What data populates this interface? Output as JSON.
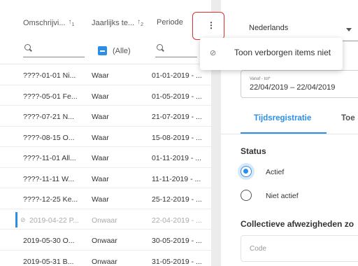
{
  "grid": {
    "columns": [
      {
        "label": "Omschrijvi...",
        "sort": "↑",
        "sort_index": "1"
      },
      {
        "label": "Jaarlijks te...",
        "sort": "↑",
        "sort_index": "2"
      },
      {
        "label": "Periode"
      }
    ],
    "menu_icon": "more-vertical-icon",
    "filter_select_all": "(Alle)",
    "rows": [
      {
        "omschrijving": "????-01-01 Ni...",
        "jaarlijks": "Waar",
        "periode": "01-01-2019 - ..."
      },
      {
        "omschrijving": "????-05-01 Fe...",
        "jaarlijks": "Waar",
        "periode": "01-05-2019 - ..."
      },
      {
        "omschrijving": "????-07-21 N...",
        "jaarlijks": "Waar",
        "periode": "21-07-2019 - ..."
      },
      {
        "omschrijving": "????-08-15 O...",
        "jaarlijks": "Waar",
        "periode": "15-08-2019 - ..."
      },
      {
        "omschrijving": "????-11-01 All...",
        "jaarlijks": "Waar",
        "periode": "01-11-2019 - ..."
      },
      {
        "omschrijving": "????-11-11 W...",
        "jaarlijks": "Waar",
        "periode": "11-11-2019 - ..."
      },
      {
        "omschrijving": "????-12-25 Ke...",
        "jaarlijks": "Waar",
        "periode": "25-12-2019 - ..."
      },
      {
        "omschrijving": "2019-04-22 P...",
        "jaarlijks": "Onwaar",
        "periode": "22-04-2019 - ...",
        "hidden": true
      },
      {
        "omschrijving": "2019-05-30 O...",
        "jaarlijks": "Onwaar",
        "periode": "30-05-2019 - ..."
      },
      {
        "omschrijving": "2019-05-31 B...",
        "jaarlijks": "Onwaar",
        "periode": "31-05-2019 - ..."
      }
    ]
  },
  "popup": {
    "icon": "eye-slash-icon",
    "label": "Toon verborgen items niet"
  },
  "right": {
    "language": "Nederlands",
    "date_label": "Vanaf - tot*",
    "date_value": "22/04/2019 – 22/04/2019",
    "tabs": [
      "Tijdsregistratie",
      "Toe"
    ],
    "status_heading": "Status",
    "status_options": [
      "Actief",
      "Niet actief"
    ],
    "status_selected": "Actief",
    "collective_heading": "Collectieve afwezigheden zo",
    "code_label": "Code"
  },
  "colors": {
    "accent": "#2d8ee6",
    "highlight_border": "#e0322a"
  }
}
